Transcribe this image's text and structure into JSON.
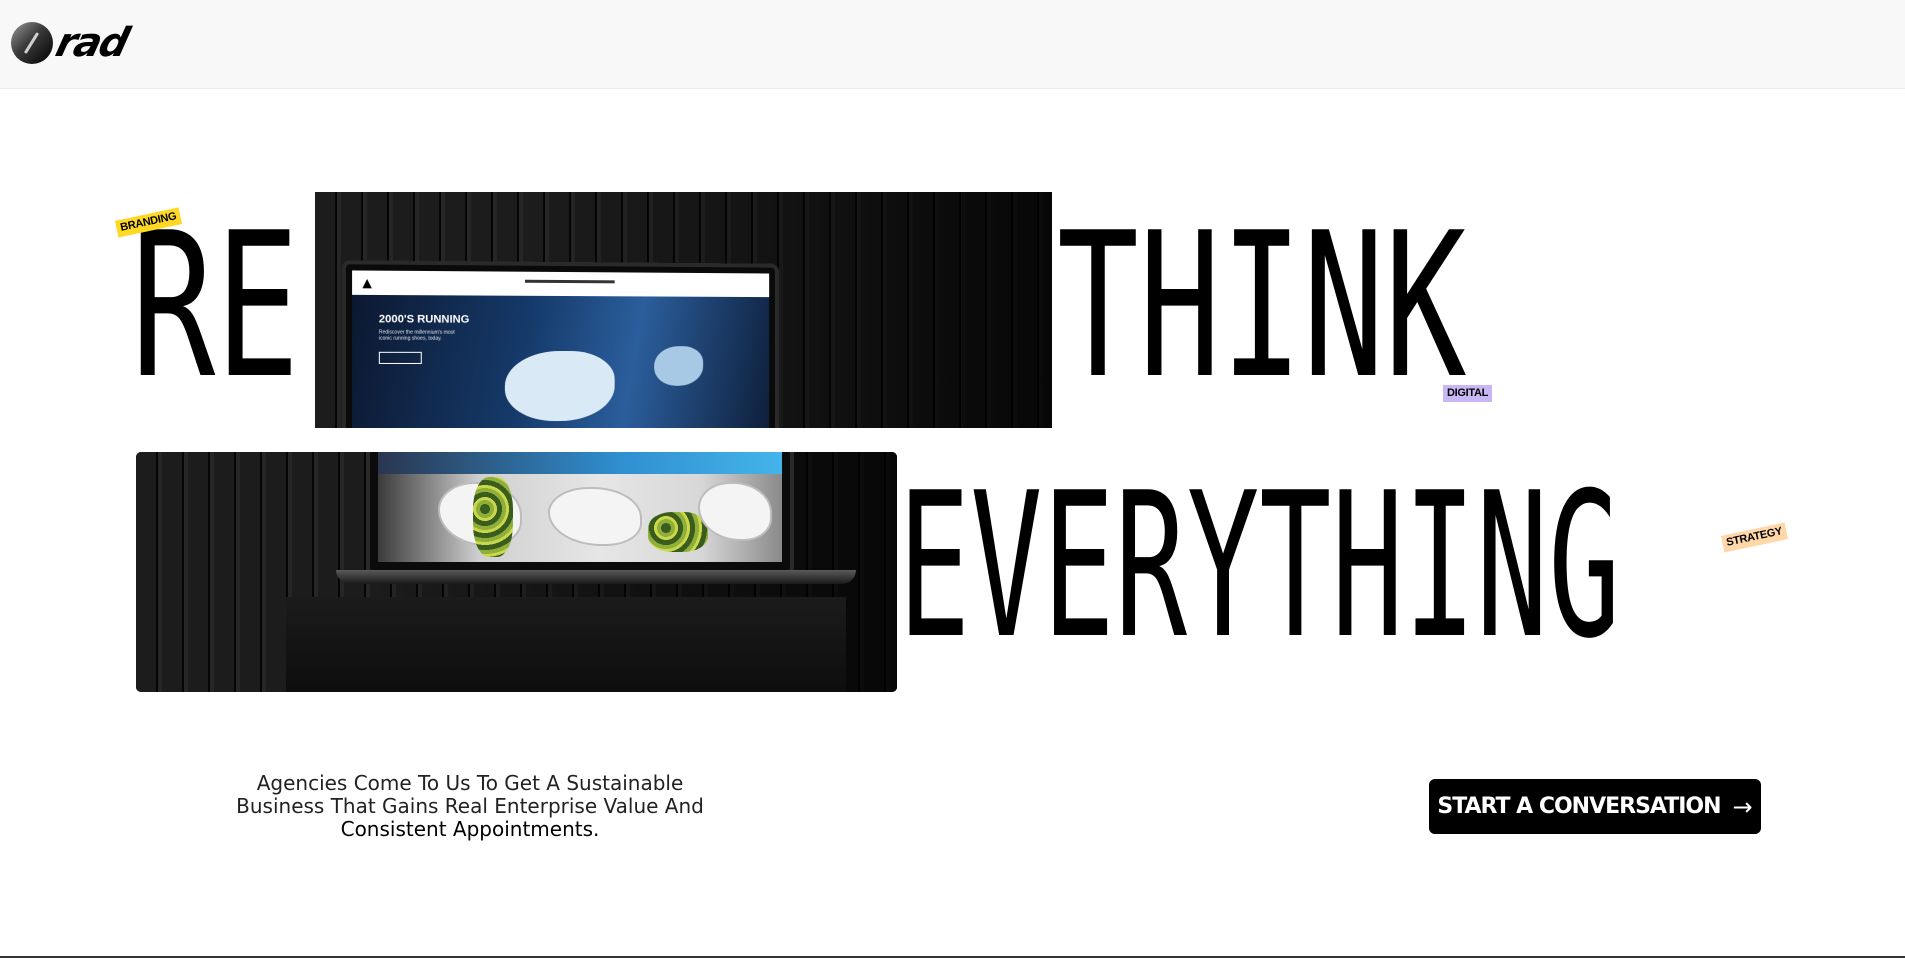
{
  "brand": {
    "logo_text": "rad"
  },
  "hero": {
    "word_re": "RE",
    "word_think": "THINK",
    "word_everything": "EVERYTHING",
    "tags": {
      "branding": "BRANDING",
      "digital": "DIGITAL",
      "strategy": "STRATEGY"
    },
    "screen": {
      "title": "2000'S RUNNING",
      "subtitle": "Rediscover the millennium's most iconic running shoes, today."
    }
  },
  "tagline": {
    "line1": "Agencies Come To Us To Get A Sustainable",
    "line2": "Business That Gains Real Enterprise Value And",
    "line3": "Consistent Appointments."
  },
  "cta": {
    "label": "START A CONVERSATION",
    "icon": "arrow-right-icon"
  },
  "colors": {
    "branding_tag": "#ffd826",
    "digital_tag": "#c9b6f4",
    "strategy_tag": "#ffd7a9",
    "button_bg": "#000000"
  }
}
